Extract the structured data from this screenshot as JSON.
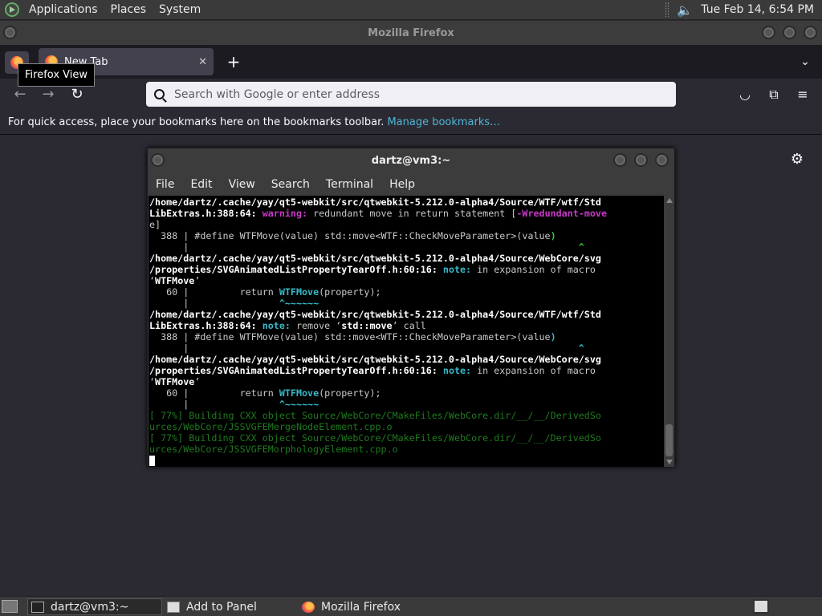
{
  "top_panel": {
    "menus": [
      "Applications",
      "Places",
      "System"
    ],
    "clock": "Tue Feb 14,  6:54 PM",
    "volume_icon": "speaker-icon"
  },
  "firefox": {
    "window_title": "Mozilla Firefox",
    "tab": {
      "label": "New Tab",
      "close": "✕"
    },
    "new_tab": "+",
    "tab_list": "⌄",
    "tooltip": "Firefox View",
    "url_placeholder": "Search with Google or enter address",
    "bookmarks_text": "For quick access, place your bookmarks here on the bookmarks toolbar.",
    "bookmarks_link": "Manage bookmarks…",
    "icons": {
      "back": "←",
      "forward": "→",
      "reload": "↻",
      "pocket": "◡",
      "extensions": "⧉",
      "menu": "≡",
      "settings": "⚙"
    }
  },
  "terminal": {
    "title": "dartz@vm3:~",
    "menus": [
      "File",
      "Edit",
      "View",
      "Search",
      "Terminal",
      "Help"
    ],
    "lines": [
      [
        {
          "t": "/home/dartz/.cache/yay/qt5-webkit/src/qtwebkit-5.212.0-alpha4/Source/WTF/wtf/Std",
          "c": "b"
        }
      ],
      [
        {
          "t": "LibExtras.h:388:64: ",
          "c": "b"
        },
        {
          "t": "warning:",
          "c": "warn"
        },
        {
          "t": " redundant move in return statement [",
          "c": ""
        },
        {
          "t": "-Wredundant-move",
          "c": "warn"
        }
      ],
      [
        {
          "t": "e]",
          "c": ""
        }
      ],
      [
        {
          "t": "  388 | #define WTFMove(value) std::move<WTF::CheckMoveParameter>(value",
          "c": ""
        },
        {
          "t": ")",
          "c": "grn"
        }
      ],
      [
        {
          "t": "      |                                                                     ",
          "c": ""
        },
        {
          "t": "^",
          "c": "grn"
        }
      ],
      [
        {
          "t": "/home/dartz/.cache/yay/qt5-webkit/src/qtwebkit-5.212.0-alpha4/Source/WebCore/svg",
          "c": "b"
        }
      ],
      [
        {
          "t": "/properties/SVGAnimatedListPropertyTearOff.h:60:16: ",
          "c": "b"
        },
        {
          "t": "note:",
          "c": "note"
        },
        {
          "t": " in expansion of macro",
          "c": ""
        }
      ],
      [
        {
          "t": "‘",
          "c": ""
        },
        {
          "t": "WTFMove",
          "c": "b"
        },
        {
          "t": "’",
          "c": ""
        }
      ],
      [
        {
          "t": "   60 |         return ",
          "c": ""
        },
        {
          "t": "WTFMove",
          "c": "note"
        },
        {
          "t": "(property);",
          "c": ""
        }
      ],
      [
        {
          "t": "      |                ",
          "c": ""
        },
        {
          "t": "^~~~~~~",
          "c": "note"
        }
      ],
      [
        {
          "t": "/home/dartz/.cache/yay/qt5-webkit/src/qtwebkit-5.212.0-alpha4/Source/WTF/wtf/Std",
          "c": "b"
        }
      ],
      [
        {
          "t": "LibExtras.h:388:64: ",
          "c": "b"
        },
        {
          "t": "note:",
          "c": "note"
        },
        {
          "t": " remove ‘",
          "c": ""
        },
        {
          "t": "std::move",
          "c": "b"
        },
        {
          "t": "’ call",
          "c": ""
        }
      ],
      [
        {
          "t": "  388 | #define WTFMove(value) std::move<WTF::CheckMoveParameter>(value",
          "c": ""
        },
        {
          "t": ")",
          "c": "note"
        }
      ],
      [
        {
          "t": "      |                                                                     ",
          "c": ""
        },
        {
          "t": "^",
          "c": "note"
        }
      ],
      [
        {
          "t": "/home/dartz/.cache/yay/qt5-webkit/src/qtwebkit-5.212.0-alpha4/Source/WebCore/svg",
          "c": "b"
        }
      ],
      [
        {
          "t": "/properties/SVGAnimatedListPropertyTearOff.h:60:16: ",
          "c": "b"
        },
        {
          "t": "note:",
          "c": "note"
        },
        {
          "t": " in expansion of macro",
          "c": ""
        }
      ],
      [
        {
          "t": "‘",
          "c": ""
        },
        {
          "t": "WTFMove",
          "c": "b"
        },
        {
          "t": "’",
          "c": ""
        }
      ],
      [
        {
          "t": "   60 |         return ",
          "c": ""
        },
        {
          "t": "WTFMove",
          "c": "note"
        },
        {
          "t": "(property);",
          "c": ""
        }
      ],
      [
        {
          "t": "      |                ",
          "c": ""
        },
        {
          "t": "^~~~~~~",
          "c": "note"
        }
      ],
      [
        {
          "t": "[ 77%] Building CXX object Source/WebCore/CMakeFiles/WebCore.dir/__/__/DerivedSo",
          "c": "dim"
        }
      ],
      [
        {
          "t": "urces/WebCore/JSSVGFEMergeNodeElement.cpp.o",
          "c": "dim"
        }
      ],
      [
        {
          "t": "[ 77%] Building CXX object Source/WebCore/CMakeFiles/WebCore.dir/__/__/DerivedSo",
          "c": "dim"
        }
      ],
      [
        {
          "t": "urces/WebCore/JSSVGFEMorphologyElement.cpp.o",
          "c": "dim"
        }
      ]
    ]
  },
  "bottom_panel": {
    "tasks": [
      "dartz@vm3:~",
      "Add to Panel",
      "Mozilla Firefox"
    ]
  }
}
